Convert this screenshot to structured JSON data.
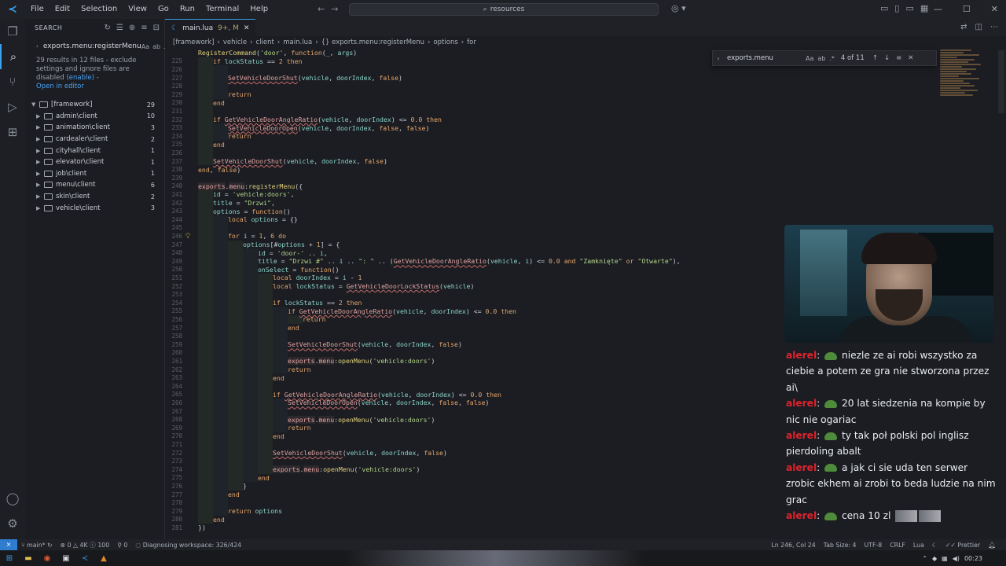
{
  "menubar": [
    "File",
    "Edit",
    "Selection",
    "View",
    "Go",
    "Run",
    "Terminal",
    "Help"
  ],
  "command_center": "resources",
  "sidebar": {
    "title": "SEARCH",
    "query": "exports.menu:registerMenu",
    "query_opts": [
      "Aa",
      "ab",
      ".*"
    ],
    "result_message": "29 results in 12 files - exclude settings and ignore files are disabled",
    "enable_link": "(enable)",
    "open_in_editor": "Open in editor",
    "tree": [
      {
        "label": "[framework]",
        "count": "29",
        "root": true
      },
      {
        "label": "admin\\client",
        "count": "10"
      },
      {
        "label": "animation\\client",
        "count": "3"
      },
      {
        "label": "cardealer\\client",
        "count": "2"
      },
      {
        "label": "cityhall\\client",
        "count": "1"
      },
      {
        "label": "elevator\\client",
        "count": "1"
      },
      {
        "label": "job\\client",
        "count": "1"
      },
      {
        "label": "menu\\client",
        "count": "6"
      },
      {
        "label": "skin\\client",
        "count": "2"
      },
      {
        "label": "vehicle\\client",
        "count": "3"
      }
    ]
  },
  "tab": {
    "lang": "lua",
    "name": "main.lua",
    "status": "9+, M"
  },
  "breadcrumb": [
    "[framework]",
    "vehicle",
    "client",
    "main.lua",
    "{} exports.menu:registerMenu",
    "options",
    "for"
  ],
  "find": {
    "query": "exports.menu",
    "opts": [
      "Aa",
      "ab",
      ".*"
    ],
    "count": "4 of 11"
  },
  "statusbar": {
    "branch": "main*",
    "problems": "0 △ 4K ⓘ 100",
    "ports": "0",
    "task": "Diagnosing workspace: 326/424",
    "position": "Ln 246, Col 24",
    "tab_size": "Tab Size: 4",
    "encoding": "UTF-8",
    "eol": "CRLF",
    "language": "Lua",
    "formatter": "Prettier"
  },
  "clock": "00:23",
  "chat": [
    {
      "user": "alerel",
      "text": "niezle ze ai robi wszystko za ciebie a potem ze gra nie stworzona przez ai\\"
    },
    {
      "user": "alerel",
      "text": "20 lat siedzenia na kompie by nic nie ogariac"
    },
    {
      "user": "alerel",
      "text": "ty tak poł polski pol inglisz pierdoling abalt"
    },
    {
      "user": "alerel",
      "text": "a jak ci sie uda ten serwer zrobic ekhem ai zrobi to beda ludzie na nim grac"
    },
    {
      "user": "alerel",
      "text": "cena 10 zl"
    }
  ],
  "code_lines": [
    {
      "n": "",
      "i": 0,
      "t": "RegisterCommand('door', function(_, args)"
    },
    {
      "n": "225",
      "i": 1,
      "t": "if lockStatus == 2 then"
    },
    {
      "n": "226",
      "i": 2,
      "t": ""
    },
    {
      "n": "227",
      "i": 2,
      "t": "SetVehicleDoorShut(vehicle, doorIndex, false)"
    },
    {
      "n": "228",
      "i": 2,
      "t": ""
    },
    {
      "n": "229",
      "i": 2,
      "t": "return"
    },
    {
      "n": "230",
      "i": 1,
      "t": "end"
    },
    {
      "n": "231",
      "i": 1,
      "t": ""
    },
    {
      "n": "232",
      "i": 1,
      "t": "if GetVehicleDoorAngleRatio(vehicle, doorIndex) <= 0.0 then"
    },
    {
      "n": "233",
      "i": 2,
      "t": "SetVehicleDoorOpen(vehicle, doorIndex, false, false)"
    },
    {
      "n": "234",
      "i": 2,
      "t": "return"
    },
    {
      "n": "235",
      "i": 1,
      "t": "end"
    },
    {
      "n": "236",
      "i": 1,
      "t": ""
    },
    {
      "n": "237",
      "i": 1,
      "t": "SetVehicleDoorShut(vehicle, doorIndex, false)"
    },
    {
      "n": "238",
      "i": 0,
      "t": "end, false)"
    },
    {
      "n": "239",
      "i": 0,
      "t": ""
    },
    {
      "n": "240",
      "i": 0,
      "t": "exports.menu:registerMenu({"
    },
    {
      "n": "241",
      "i": 1,
      "t": "id = 'vehicle:doors',"
    },
    {
      "n": "242",
      "i": 1,
      "t": "title = \"Drzwi\","
    },
    {
      "n": "243",
      "i": 1,
      "t": "options = function()"
    },
    {
      "n": "244",
      "i": 2,
      "t": "local options = {}"
    },
    {
      "n": "245",
      "i": 2,
      "t": ""
    },
    {
      "n": "246",
      "i": 2,
      "t": "for i = 1, 6 do"
    },
    {
      "n": "247",
      "i": 3,
      "t": "options[#options + 1] = {"
    },
    {
      "n": "248",
      "i": 4,
      "t": "id = 'door-' .. i,"
    },
    {
      "n": "249",
      "i": 4,
      "t": "title = \"Drzwi #\" .. i .. \": \" .. (GetVehicleDoorAngleRatio(vehicle, i) <= 0.0 and \"Zamknięte\" or \"Otwarte\"),"
    },
    {
      "n": "250",
      "i": 4,
      "t": "onSelect = function()"
    },
    {
      "n": "251",
      "i": 5,
      "t": "local doorIndex = i - 1"
    },
    {
      "n": "252",
      "i": 5,
      "t": "local lockStatus = GetVehicleDoorLockStatus(vehicle)"
    },
    {
      "n": "253",
      "i": 5,
      "t": ""
    },
    {
      "n": "254",
      "i": 5,
      "t": "if lockStatus == 2 then"
    },
    {
      "n": "255",
      "i": 6,
      "t": "if GetVehicleDoorAngleRatio(vehicle, doorIndex) <= 0.0 then"
    },
    {
      "n": "256",
      "i": 7,
      "t": "return"
    },
    {
      "n": "257",
      "i": 6,
      "t": "end"
    },
    {
      "n": "258",
      "i": 6,
      "t": ""
    },
    {
      "n": "259",
      "i": 6,
      "t": "SetVehicleDoorShut(vehicle, doorIndex, false)"
    },
    {
      "n": "260",
      "i": 6,
      "t": ""
    },
    {
      "n": "261",
      "i": 6,
      "t": "exports.menu:openMenu('vehicle:doors')"
    },
    {
      "n": "262",
      "i": 6,
      "t": "return"
    },
    {
      "n": "263",
      "i": 5,
      "t": "end"
    },
    {
      "n": "264",
      "i": 5,
      "t": ""
    },
    {
      "n": "265",
      "i": 5,
      "t": "if GetVehicleDoorAngleRatio(vehicle, doorIndex) <= 0.0 then"
    },
    {
      "n": "266",
      "i": 6,
      "t": "SetVehicleDoorOpen(vehicle, doorIndex, false, false)"
    },
    {
      "n": "267",
      "i": 6,
      "t": ""
    },
    {
      "n": "268",
      "i": 6,
      "t": "exports.menu:openMenu('vehicle:doors')"
    },
    {
      "n": "269",
      "i": 6,
      "t": "return"
    },
    {
      "n": "270",
      "i": 5,
      "t": "end"
    },
    {
      "n": "271",
      "i": 5,
      "t": ""
    },
    {
      "n": "272",
      "i": 5,
      "t": "SetVehicleDoorShut(vehicle, doorIndex, false)"
    },
    {
      "n": "273",
      "i": 5,
      "t": ""
    },
    {
      "n": "274",
      "i": 5,
      "t": "exports.menu:openMenu('vehicle:doors')"
    },
    {
      "n": "275",
      "i": 4,
      "t": "end"
    },
    {
      "n": "276",
      "i": 3,
      "t": "}"
    },
    {
      "n": "277",
      "i": 2,
      "t": "end"
    },
    {
      "n": "278",
      "i": 2,
      "t": ""
    },
    {
      "n": "279",
      "i": 2,
      "t": "return options"
    },
    {
      "n": "280",
      "i": 1,
      "t": "end"
    },
    {
      "n": "281",
      "i": 0,
      "t": "})"
    }
  ]
}
